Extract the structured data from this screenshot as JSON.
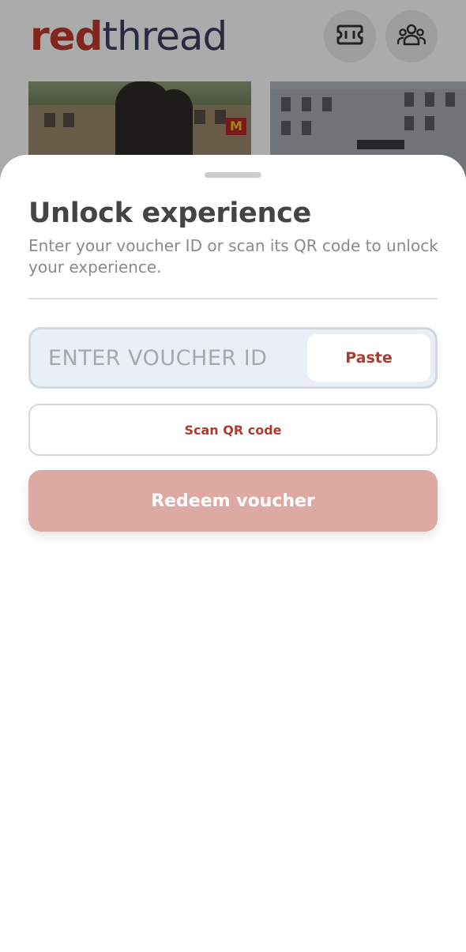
{
  "app": {
    "logo_part1": "red",
    "logo_part2": "thread",
    "header_icons": [
      "ticket-icon",
      "people-icon"
    ],
    "brand_color": "#c0392b",
    "logo_secondary_color": "#3d3f63"
  },
  "sheet": {
    "title": "Unlock experience",
    "subtitle": "Enter your voucher ID or scan its QR code to unlock your experience.",
    "voucher": {
      "value": "",
      "placeholder": "ENTER VOUCHER ID",
      "paste_label": "Paste"
    },
    "scan_label": "Scan QR code",
    "redeem_label": "Redeem voucher",
    "accent_color": "#b03a2e",
    "redeem_disabled_color": "#dfa9a3"
  }
}
